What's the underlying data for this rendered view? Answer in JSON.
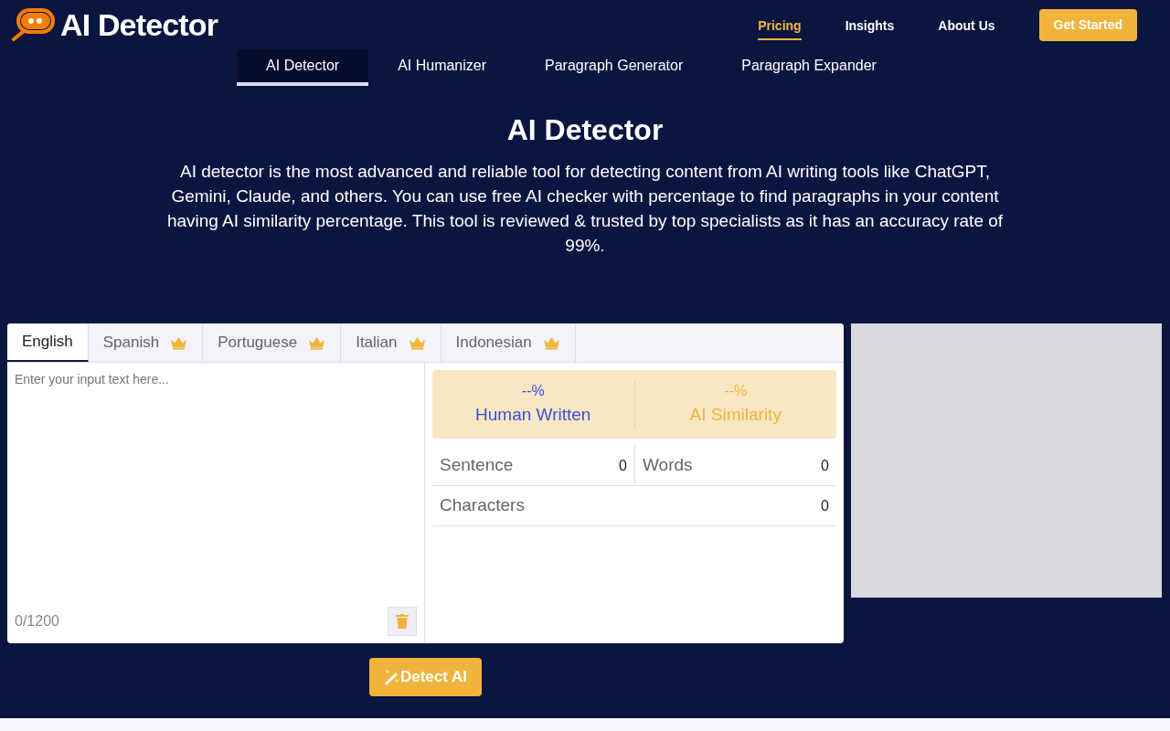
{
  "header": {
    "logo": "AI Detector",
    "nav": [
      {
        "label": "Pricing",
        "selected": true
      },
      {
        "label": "Insights",
        "selected": false
      },
      {
        "label": "About Us",
        "selected": false
      }
    ],
    "cta": "Get Started"
  },
  "tool_tabs": [
    {
      "label": "AI Detector",
      "selected": true
    },
    {
      "label": "AI Humanizer",
      "selected": false
    },
    {
      "label": "Paragraph Generator",
      "selected": false
    },
    {
      "label": "Paragraph Expander",
      "selected": false
    }
  ],
  "title": "AI Detector",
  "description": "AI detector is the most advanced and reliable tool for detecting content from AI writing tools like ChatGPT, Gemini, Claude, and others. You can use free AI checker with percentage to find paragraphs in your content having AI similarity percentage. This tool is reviewed & trusted by top specialists as it has an accuracy rate of 99%.",
  "language_tabs": [
    {
      "label": "English",
      "selected": true,
      "premium": false
    },
    {
      "label": "Spanish",
      "selected": false,
      "premium": true
    },
    {
      "label": "Portuguese",
      "selected": false,
      "premium": true
    },
    {
      "label": "Italian",
      "selected": false,
      "premium": true
    },
    {
      "label": "Indonesian",
      "selected": false,
      "premium": true
    }
  ],
  "input": {
    "placeholder": "Enter your input text here...",
    "counter": "0/1200"
  },
  "scores": [
    {
      "value": "--%",
      "label": "Human Written",
      "color": "#3b4fd8"
    },
    {
      "value": "--%",
      "label": "AI Similarity",
      "color": "#f0b43c"
    }
  ],
  "stats": [
    {
      "label": "Sentence",
      "value": "0"
    },
    {
      "label": "Words",
      "value": "0"
    },
    {
      "label": "Characters",
      "value": "0"
    }
  ],
  "detect_button": "Detect AI"
}
